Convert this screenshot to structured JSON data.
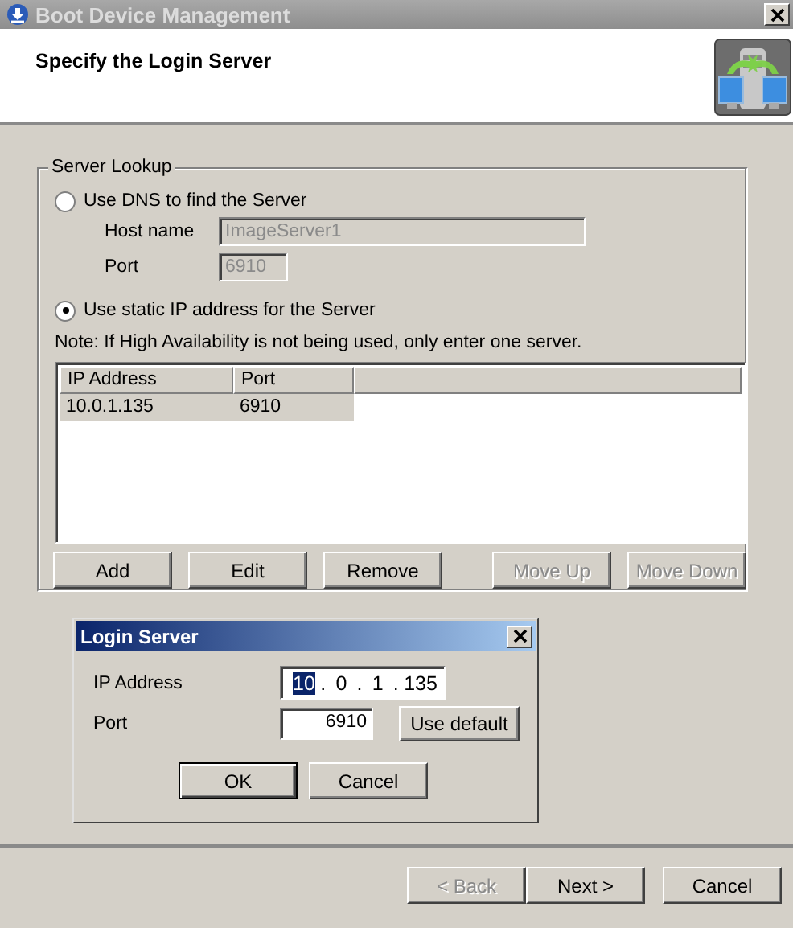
{
  "window": {
    "title": "Boot Device Management"
  },
  "header": {
    "title": "Specify the Login Server"
  },
  "server_lookup": {
    "title": "Server Lookup",
    "options": [
      {
        "kind": "dns",
        "label": "Use DNS to find the Server",
        "selected": false
      },
      {
        "kind": "static",
        "label": "Use static IP address for the Server",
        "selected": true
      }
    ],
    "host_name": {
      "label": "Host name",
      "value": "ImageServer1",
      "disabled": true
    },
    "port": {
      "label": "Port",
      "value": "6910",
      "disabled": true
    },
    "note": "Note: If High Availability is not being used, only enter one server.",
    "table": {
      "columns": [
        "IP Address",
        "Port"
      ],
      "rows": [
        {
          "cells": [
            "10.0.1.135",
            "6910"
          ],
          "selected": true
        }
      ]
    },
    "buttons": [
      {
        "label": "Add",
        "disabled": false
      },
      {
        "label": "Edit",
        "disabled": false
      },
      {
        "label": "Remove",
        "disabled": false
      },
      {
        "label": "Move Up",
        "disabled": true
      },
      {
        "label": "Move Down",
        "disabled": true
      }
    ]
  },
  "dialog": {
    "title": "Login Server",
    "ip_address": {
      "label": "IP Address",
      "separator": ".",
      "octets": [
        {
          "text": "10",
          "selected": true
        },
        {
          "text": "0",
          "selected": false
        },
        {
          "text": "1",
          "selected": false
        },
        {
          "text": "135",
          "selected": false
        }
      ]
    },
    "port": {
      "label": "Port",
      "value": "6910"
    },
    "use_default": "Use default",
    "buttons": [
      {
        "label": "OK",
        "default": true
      },
      {
        "label": "Cancel",
        "default": false
      }
    ]
  },
  "buttons": [
    {
      "label": "< Back",
      "disabled": true
    },
    {
      "label": "Next >",
      "disabled": false
    },
    {
      "label": "Cancel",
      "disabled": false
    }
  ]
}
